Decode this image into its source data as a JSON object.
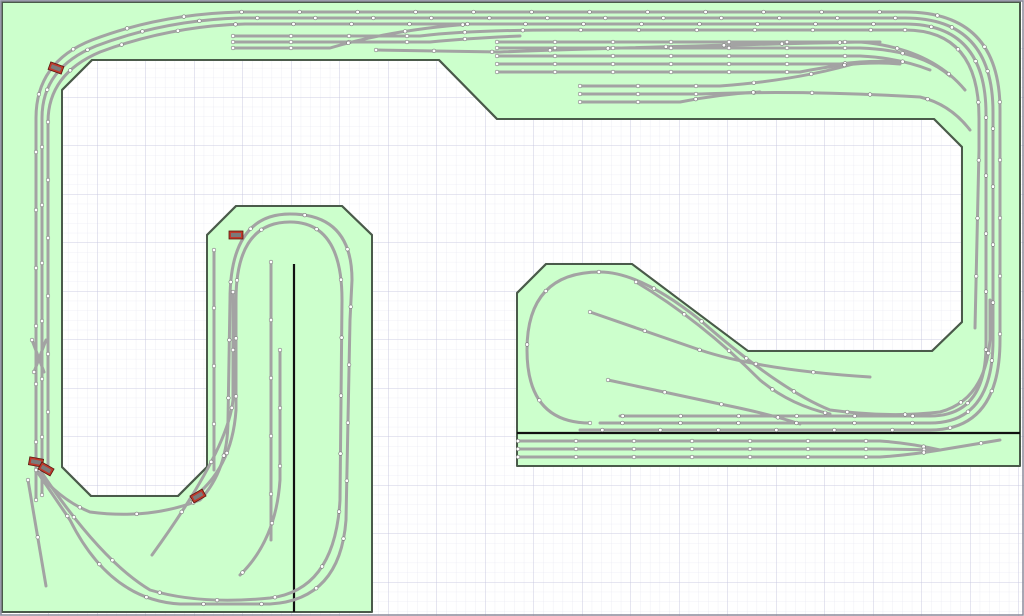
{
  "colors": {
    "background": "#ffffff",
    "grid_minor": "#e3e3ef",
    "grid_major": "#c2c2dc",
    "board_fill": "#ccffcc",
    "board_outline": "#4a5a4a",
    "track": "#a3a3a3",
    "track_edge": "#8a8a8a",
    "sleeper_marks": "#555555",
    "node": "#ffffff",
    "divider": "#111111",
    "train_body": "#c0392b",
    "train_roof": "#7a7a7a"
  },
  "icons": {
    "locomotive": "locomotive-icon",
    "node": "track-node-icon"
  }
}
